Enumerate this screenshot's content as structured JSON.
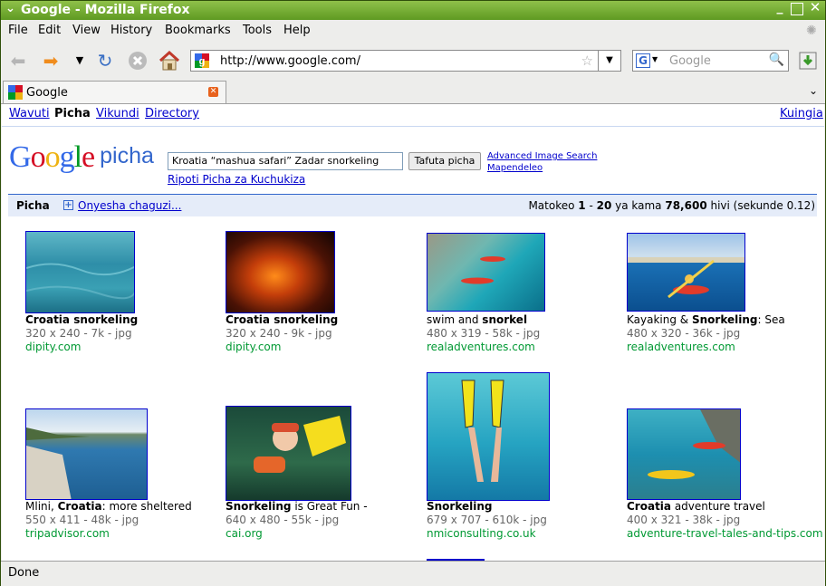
{
  "window": {
    "title": "Google - Mozilla Firefox"
  },
  "menu": {
    "file": "File",
    "edit": "Edit",
    "view": "View",
    "history": "History",
    "bookmarks": "Bookmarks",
    "tools": "Tools",
    "help": "Help"
  },
  "toolbar": {
    "url": "http://www.google.com/",
    "search_placeholder": "Google"
  },
  "tab": {
    "label": "Google"
  },
  "topnav": {
    "items": [
      "Wavuti",
      "Picha",
      "Vikundi",
      "Directory"
    ],
    "right": "Kuingia"
  },
  "logo": {
    "google": "Google",
    "picha": "picha"
  },
  "search": {
    "query": "Kroatia “mashua safari” Zadar snorkeling",
    "button": "Tafuta picha",
    "advanced": "Advanced Image Search",
    "prefs": "Mapendeleo",
    "report": "Ripoti Picha za Kuchukiza"
  },
  "results_bar": {
    "label": "Picha",
    "options": "Onyesha chaguzi...",
    "prefix": "Matokeo ",
    "from": "1",
    "dash": " - ",
    "to": "20",
    "mid": " ya kama ",
    "total": "78,600",
    "suffix": " hivi (sekunde 0.12)"
  },
  "results": [
    {
      "t1": "Croatia snorkeling",
      "t2": "",
      "t3": "",
      "meta": "320 x 240 - 7k - jpg",
      "host": "dipity.com"
    },
    {
      "t1": "Croatia snorkeling",
      "t2": "",
      "t3": "",
      "meta": "320 x 240 - 9k - jpg",
      "host": "dipity.com"
    },
    {
      "t1": "swim and ",
      "t2": "snorkel",
      "t3": "",
      "meta": "480 x 319 - 58k - jpg",
      "host": "realadventures.com"
    },
    {
      "t1": "Kayaking & ",
      "t2": "Snorkeling",
      "t3": ": Sea",
      "meta": "480 x 320 - 36k - jpg",
      "host": "realadventures.com"
    },
    {
      "t1": "Mlini, ",
      "t2": "Croatia",
      "t3": ": more sheltered",
      "meta": "550 x 411 - 48k - jpg",
      "host": "tripadvisor.com"
    },
    {
      "t1": "Snorkeling",
      "t2": " is Great Fun -",
      "t3": "",
      "meta": "640 x 480 - 55k - jpg",
      "host": "cai.org"
    },
    {
      "t1": "Snorkeling",
      "t2": "",
      "t3": "",
      "meta": "679 x 707 - 610k - jpg",
      "host": "nmiconsulting.co.uk"
    },
    {
      "t1": "Croatia",
      "t2": " adventure travel",
      "t3": "",
      "meta": "400 x 321 - 38k - jpg",
      "host": "adventure-travel-tales-and-tips.com"
    }
  ],
  "status": {
    "text": "Done"
  }
}
